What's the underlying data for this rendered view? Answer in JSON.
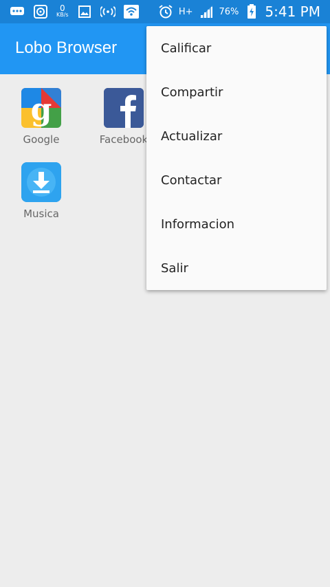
{
  "status_bar": {
    "net_speed_value": "0",
    "net_speed_unit": "KB/s",
    "network_type": "H+",
    "battery_percent": "76%",
    "time": "5:41 PM",
    "icons": [
      "message-icon",
      "sync-icon",
      "image-icon",
      "hotspot-icon",
      "wifi-icon",
      "alarm-icon",
      "signal-icon",
      "battery-charging-icon"
    ]
  },
  "app_bar": {
    "title": "Lobo Browser"
  },
  "shortcuts": [
    {
      "label": "Google",
      "icon": "google-icon"
    },
    {
      "label": "Facebook",
      "icon": "facebook-icon"
    },
    {
      "label": "Musica",
      "icon": "download-icon"
    }
  ],
  "menu": {
    "items": [
      "Calificar",
      "Compartir",
      "Actualizar",
      "Contactar",
      "Informacion",
      "Salir"
    ]
  },
  "colors": {
    "status_bar": "#1a82d6",
    "app_bar": "#2196f3",
    "background": "#ededed",
    "menu_bg": "#fafafa"
  }
}
